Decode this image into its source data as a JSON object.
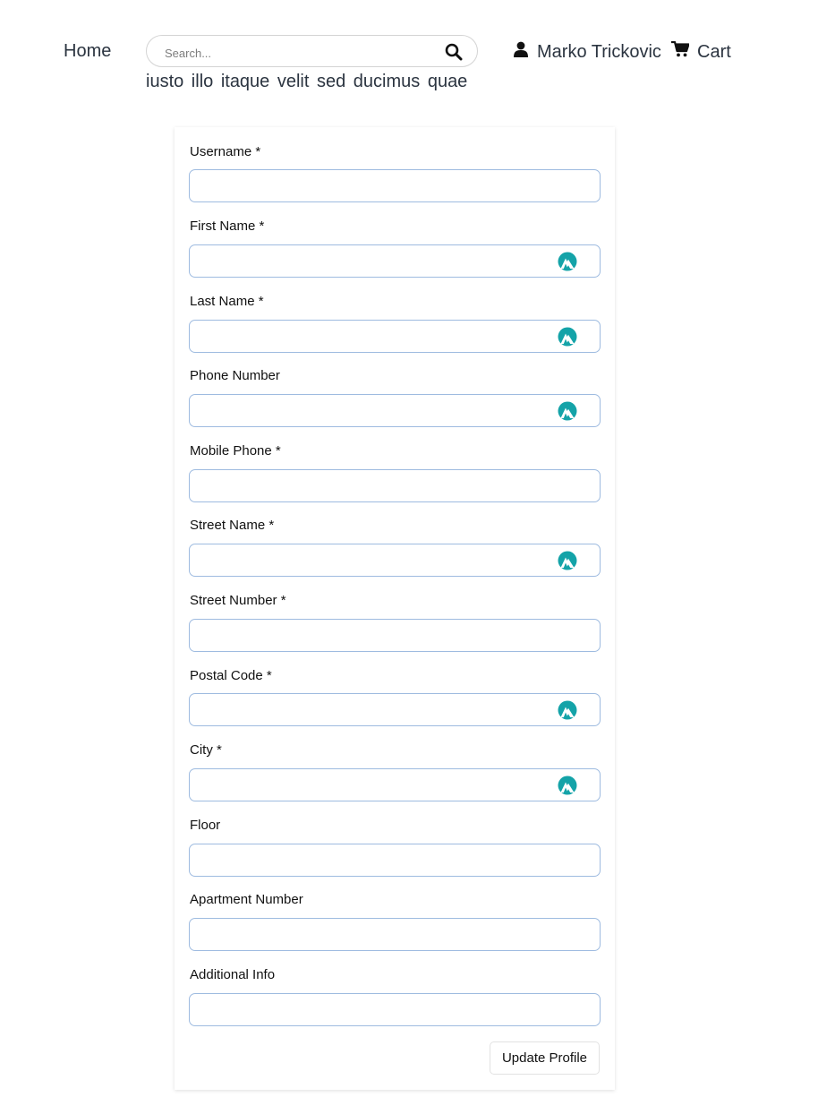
{
  "header": {
    "home_label": "Home",
    "search_placeholder": "Search...",
    "search_suggestion": "iusto illo itaque velit sed ducimus quae",
    "user_name": "Marko Trickovic",
    "cart_label": "Cart"
  },
  "form": {
    "fields": [
      {
        "label": "Username *",
        "value": "",
        "autofill": false
      },
      {
        "label": "First Name *",
        "value": "",
        "autofill": true
      },
      {
        "label": "Last Name *",
        "value": "",
        "autofill": true
      },
      {
        "label": "Phone Number",
        "value": "",
        "autofill": true
      },
      {
        "label": "Mobile Phone *",
        "value": "",
        "autofill": false
      },
      {
        "label": "Street Name *",
        "value": "",
        "autofill": true
      },
      {
        "label": "Street Number *",
        "value": "",
        "autofill": false
      },
      {
        "label": "Postal Code *",
        "value": "",
        "autofill": true
      },
      {
        "label": "City *",
        "value": "",
        "autofill": true
      },
      {
        "label": "Floor",
        "value": "",
        "autofill": false
      },
      {
        "label": "Apartment Number",
        "value": "",
        "autofill": false
      },
      {
        "label": "Additional Info",
        "value": "",
        "autofill": false
      }
    ],
    "submit_label": "Update Profile"
  },
  "colors": {
    "input_border": "#9ebbe0",
    "autofill_icon": "#14a3a8",
    "nav_text": "#2b3440"
  }
}
